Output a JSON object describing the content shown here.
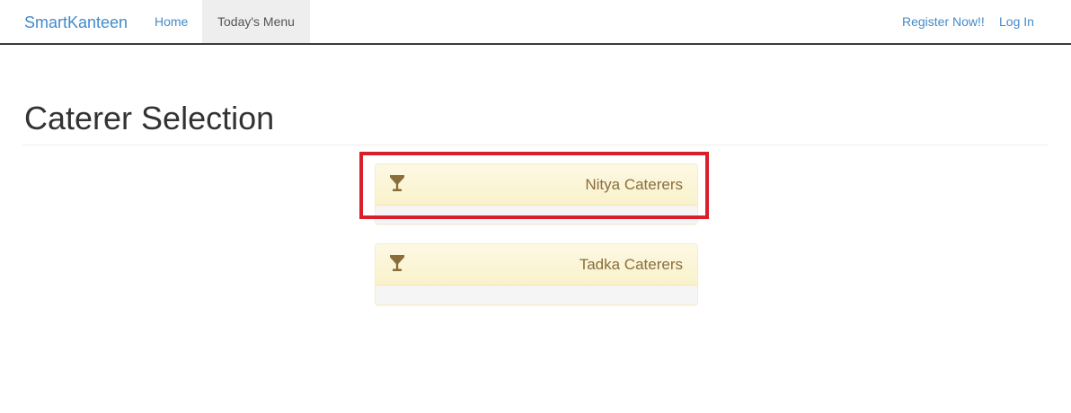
{
  "navbar": {
    "brand": "SmartKanteen",
    "links": [
      {
        "label": "Home"
      },
      {
        "label": "Today's Menu"
      }
    ],
    "right_links": [
      {
        "label": "Register Now!!"
      },
      {
        "label": "Log In"
      }
    ]
  },
  "page": {
    "title": "Caterer Selection"
  },
  "caterers": [
    {
      "name": "Nitya Caterers",
      "icon": "cocktail-glass-icon"
    },
    {
      "name": "Tadka Caterers",
      "icon": "cocktail-glass-icon"
    }
  ],
  "colors": {
    "link": "#428bca",
    "active_nav_bg": "#eeeeee",
    "panel_heading_bg": "#fcf8e3",
    "panel_heading_text": "#8a6d3b",
    "highlight_border": "#d9202a"
  }
}
